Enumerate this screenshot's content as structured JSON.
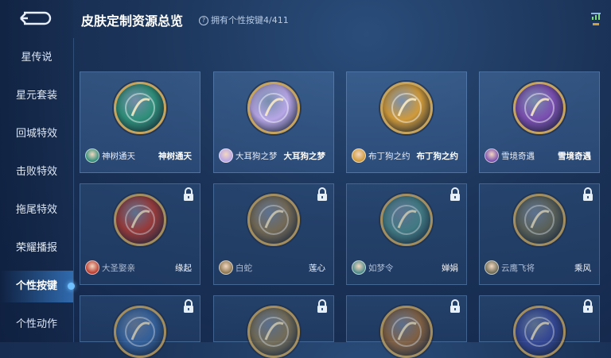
{
  "header": {
    "title": "皮肤定制资源总览",
    "subtitle": "拥有个性按键4/411"
  },
  "sidebar": {
    "items": [
      {
        "label": "星传说"
      },
      {
        "label": "星元套装"
      },
      {
        "label": "回城特效"
      },
      {
        "label": "击败特效"
      },
      {
        "label": "拖尾特效"
      },
      {
        "label": "荣耀播报"
      },
      {
        "label": "个性按键"
      },
      {
        "label": "个性动作"
      }
    ],
    "active_index": 6
  },
  "cards": [
    {
      "hero": "神树通天",
      "skin": "神树通天",
      "locked": false,
      "color": "#2f8f7a"
    },
    {
      "hero": "大耳狗之梦",
      "skin": "大耳狗之梦",
      "locked": false,
      "color": "#b7a6e6"
    },
    {
      "hero": "布丁狗之约",
      "skin": "布丁狗之约",
      "locked": false,
      "color": "#d09a3a"
    },
    {
      "hero": "雪境奇遇",
      "skin": "雪境奇遇",
      "locked": false,
      "color": "#7a4fb0"
    },
    {
      "hero": "大圣娶亲",
      "skin": "缘起",
      "locked": true,
      "color": "#b83a2e"
    },
    {
      "hero": "白蛇",
      "skin": "莲心",
      "locked": true,
      "color": "#8a7550"
    },
    {
      "hero": "如梦令",
      "skin": "婵娟",
      "locked": true,
      "color": "#4a8a8a"
    },
    {
      "hero": "云鹰飞将",
      "skin": "乘风",
      "locked": true,
      "color": "#6a6a55"
    },
    {
      "hero": "",
      "skin": "",
      "locked": true,
      "color": "#3a6aa8"
    },
    {
      "hero": "",
      "skin": "",
      "locked": true,
      "color": "#8a7a55"
    },
    {
      "hero": "",
      "skin": "",
      "locked": true,
      "color": "#9a6a3a"
    },
    {
      "hero": "",
      "skin": "",
      "locked": true,
      "color": "#3a4aa0"
    }
  ]
}
